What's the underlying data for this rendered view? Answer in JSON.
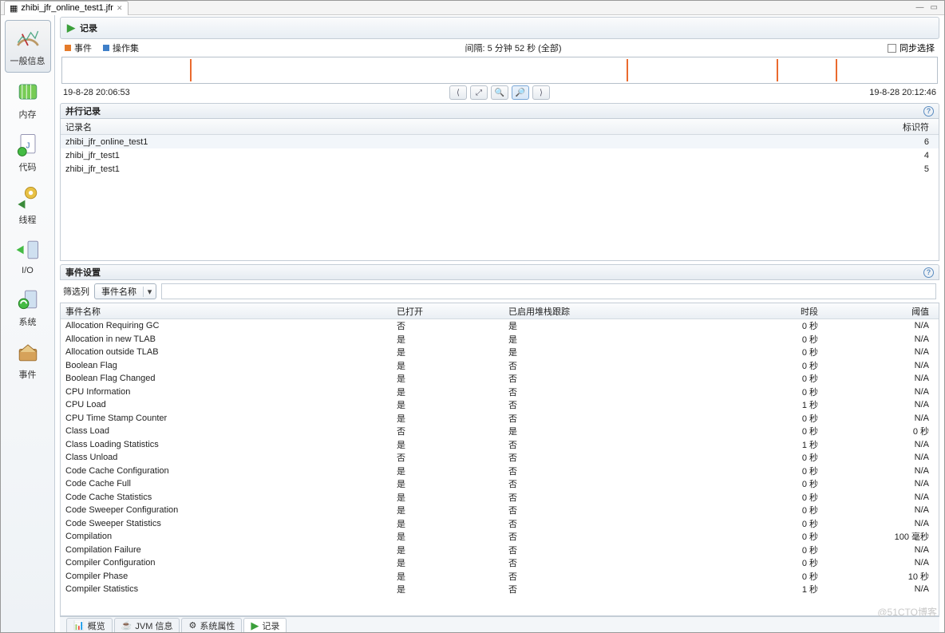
{
  "tab": {
    "filename": "zhibi_jfr_online_test1.jfr"
  },
  "page": {
    "title": "记录"
  },
  "legend": {
    "events": "事件",
    "opsets": "操作集",
    "interval": "间隔: 5 分钟 52 秒 (全部)",
    "sync": "同步选择"
  },
  "timeline": {
    "start": "19-8-28 20:06:53",
    "end": "19-8-28 20:12:46",
    "ticks_pct": [
      14.6,
      64.5,
      81.7,
      88.4
    ]
  },
  "sections": {
    "records": "并行记录",
    "events": "事件设置"
  },
  "records": {
    "col_name": "记录名",
    "col_id": "标识符",
    "rows": [
      {
        "name": "zhibi_jfr_online_test1",
        "id": "6"
      },
      {
        "name": "zhibi_jfr_test1",
        "id": "4"
      },
      {
        "name": "zhibi_jfr_test1",
        "id": "5"
      }
    ]
  },
  "filter": {
    "label": "筛选列",
    "combo": "事件名称"
  },
  "events": {
    "col_name": "事件名称",
    "col_open": "已打开",
    "col_stack": "已启用堆栈跟踪",
    "col_period": "时段",
    "col_thresh": "阈值",
    "rows": [
      {
        "name": "Allocation Requiring GC",
        "open": "否",
        "stack": "是",
        "period": "0 秒",
        "thresh": "N/A"
      },
      {
        "name": "Allocation in new TLAB",
        "open": "是",
        "stack": "是",
        "period": "0 秒",
        "thresh": "N/A"
      },
      {
        "name": "Allocation outside TLAB",
        "open": "是",
        "stack": "是",
        "period": "0 秒",
        "thresh": "N/A"
      },
      {
        "name": "Boolean Flag",
        "open": "是",
        "stack": "否",
        "period": "0 秒",
        "thresh": "N/A"
      },
      {
        "name": "Boolean Flag Changed",
        "open": "是",
        "stack": "否",
        "period": "0 秒",
        "thresh": "N/A"
      },
      {
        "name": "CPU Information",
        "open": "是",
        "stack": "否",
        "period": "0 秒",
        "thresh": "N/A"
      },
      {
        "name": "CPU Load",
        "open": "是",
        "stack": "否",
        "period": "1 秒",
        "thresh": "N/A"
      },
      {
        "name": "CPU Time Stamp Counter",
        "open": "是",
        "stack": "否",
        "period": "0 秒",
        "thresh": "N/A"
      },
      {
        "name": "Class Load",
        "open": "否",
        "stack": "是",
        "period": "0 秒",
        "thresh": "0 秒"
      },
      {
        "name": "Class Loading Statistics",
        "open": "是",
        "stack": "否",
        "period": "1 秒",
        "thresh": "N/A"
      },
      {
        "name": "Class Unload",
        "open": "否",
        "stack": "否",
        "period": "0 秒",
        "thresh": "N/A"
      },
      {
        "name": "Code Cache Configuration",
        "open": "是",
        "stack": "否",
        "period": "0 秒",
        "thresh": "N/A"
      },
      {
        "name": "Code Cache Full",
        "open": "是",
        "stack": "否",
        "period": "0 秒",
        "thresh": "N/A"
      },
      {
        "name": "Code Cache Statistics",
        "open": "是",
        "stack": "否",
        "period": "0 秒",
        "thresh": "N/A"
      },
      {
        "name": "Code Sweeper Configuration",
        "open": "是",
        "stack": "否",
        "period": "0 秒",
        "thresh": "N/A"
      },
      {
        "name": "Code Sweeper Statistics",
        "open": "是",
        "stack": "否",
        "period": "0 秒",
        "thresh": "N/A"
      },
      {
        "name": "Compilation",
        "open": "是",
        "stack": "否",
        "period": "0 秒",
        "thresh": "100 毫秒"
      },
      {
        "name": "Compilation Failure",
        "open": "是",
        "stack": "否",
        "period": "0 秒",
        "thresh": "N/A"
      },
      {
        "name": "Compiler Configuration",
        "open": "是",
        "stack": "否",
        "period": "0 秒",
        "thresh": "N/A"
      },
      {
        "name": "Compiler Phase",
        "open": "是",
        "stack": "否",
        "period": "0 秒",
        "thresh": "10 秒"
      },
      {
        "name": "Compiler Statistics",
        "open": "是",
        "stack": "否",
        "period": "1 秒",
        "thresh": "N/A"
      }
    ]
  },
  "sidebar": {
    "items": [
      {
        "label": "一般信息"
      },
      {
        "label": "内存"
      },
      {
        "label": "代码"
      },
      {
        "label": "线程"
      },
      {
        "label": "I/O"
      },
      {
        "label": "系统"
      },
      {
        "label": "事件"
      }
    ]
  },
  "bottom_tabs": {
    "overview": "概览",
    "jvm": "JVM 信息",
    "sysprops": "系统属性",
    "record": "记录"
  },
  "watermark": "@51CTO博客"
}
